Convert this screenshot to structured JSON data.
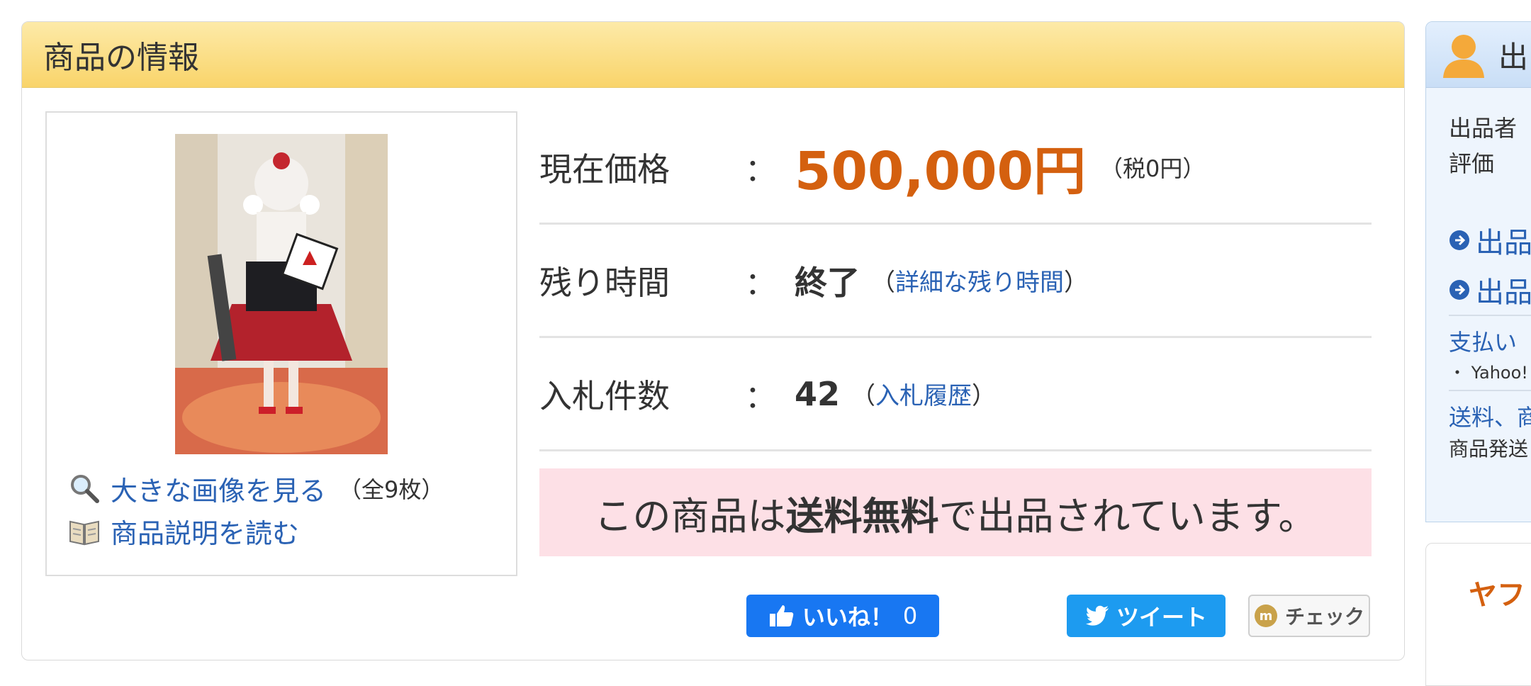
{
  "panel": {
    "title": "商品の情報"
  },
  "images": {
    "view_large": "大きな画像を見る",
    "count_note": "（全9枚）",
    "read_description": "商品説明を読む"
  },
  "info": {
    "price": {
      "label": "現在価格",
      "value": "500,000円",
      "tax": "（税0円）"
    },
    "time_left": {
      "label": "残り時間",
      "value": "終了",
      "link": "詳細な残り時間"
    },
    "bids": {
      "label": "入札件数",
      "value": "42",
      "link": "入札履歴"
    },
    "colon": "：",
    "free_shipping": {
      "pre": "この商品は",
      "bold": "送料無料",
      "post": "で出品されています。"
    }
  },
  "social": {
    "like": "いいね！",
    "like_count": "0",
    "tweet": "ツイート",
    "check": "チェック"
  },
  "seller": {
    "title": "出",
    "seller_label": "出品者",
    "rating_label": "評価",
    "link1": "出品",
    "link2": "出品",
    "payment": "支払い",
    "payment_item": "・ Yahoo!",
    "shipping": "送料、商",
    "shipping_note": "商品発送"
  },
  "promo": {
    "title": "ヤフ"
  },
  "colors": {
    "price": "#d4600f",
    "link": "#2a62b4",
    "header": "#f9d46a",
    "free_bg": "#fde0e6"
  }
}
